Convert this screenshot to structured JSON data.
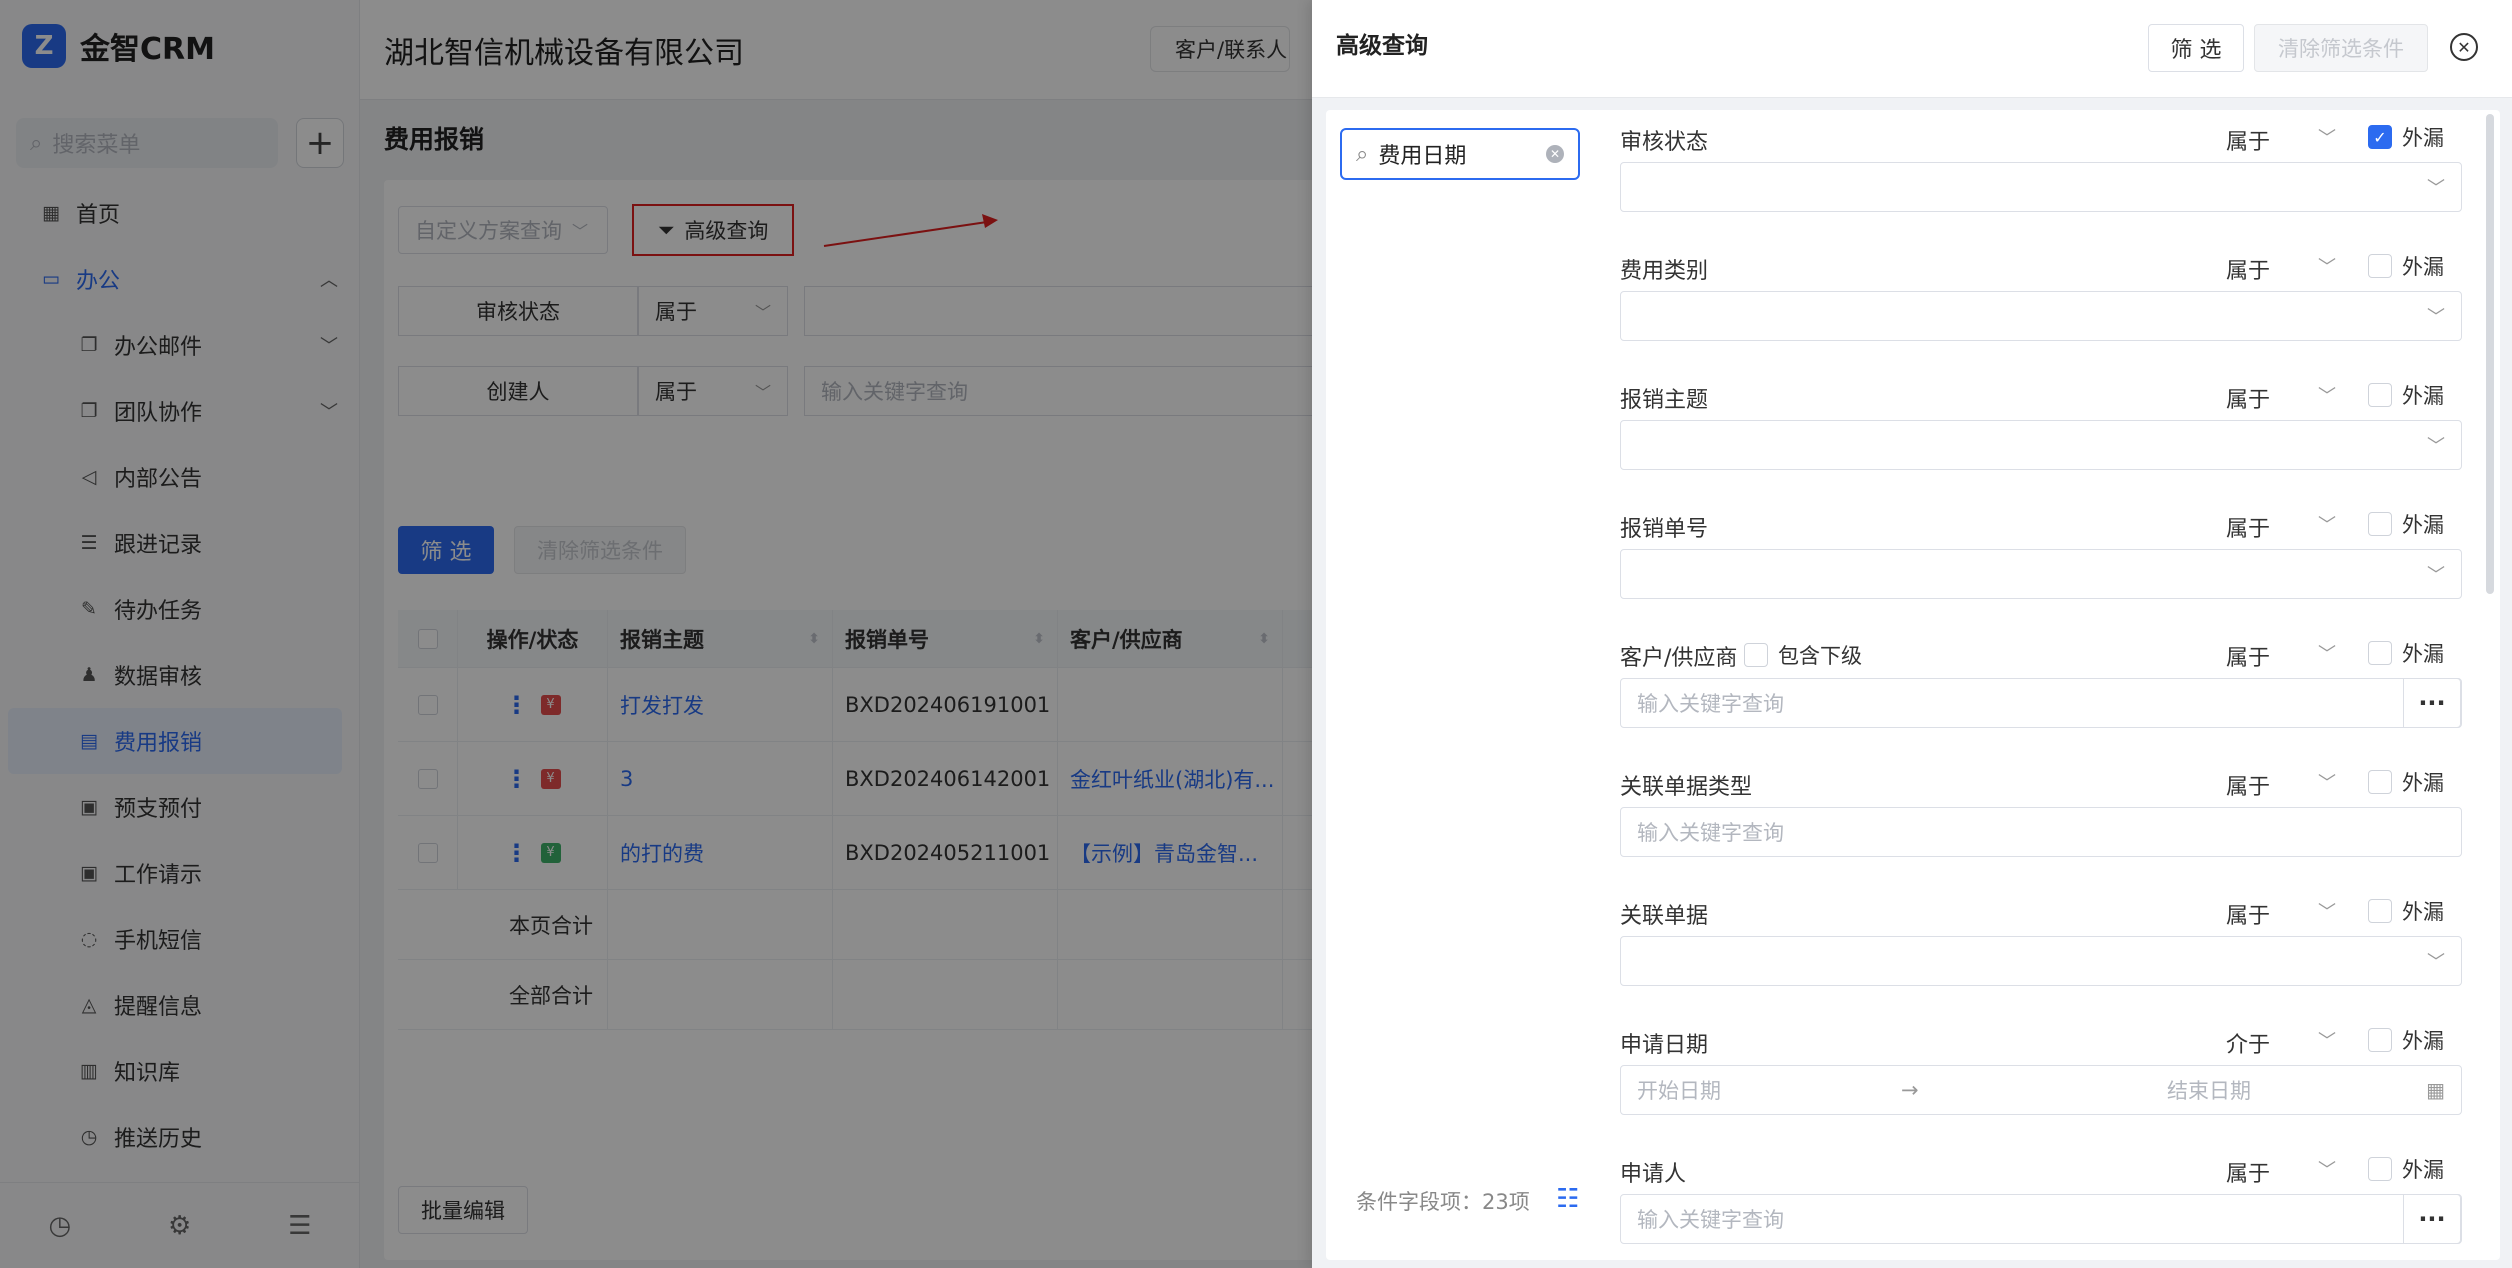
{
  "brand": {
    "logo_letter": "Z",
    "name": "金智CRM"
  },
  "sidebar": {
    "search_placeholder": "搜索菜单",
    "add_symbol": "+",
    "items": [
      {
        "label": "首页",
        "icon": "home-icon",
        "glyph": "▦"
      },
      {
        "label": "办公",
        "icon": "office-icon",
        "glyph": "▭"
      },
      {
        "label": "办公邮件",
        "icon": "mail-icon",
        "glyph": "❐"
      },
      {
        "label": "团队协作",
        "icon": "team-icon",
        "glyph": "❐"
      },
      {
        "label": "内部公告",
        "icon": "announce-icon",
        "glyph": "◁"
      },
      {
        "label": "跟进记录",
        "icon": "record-icon",
        "glyph": "☰"
      },
      {
        "label": "待办任务",
        "icon": "pin-icon",
        "glyph": "✎"
      },
      {
        "label": "数据审核",
        "icon": "audit-icon",
        "glyph": "♟"
      },
      {
        "label": "费用报销",
        "icon": "expense-icon",
        "glyph": "▤"
      },
      {
        "label": "预支预付",
        "icon": "prepay-icon",
        "glyph": "▣"
      },
      {
        "label": "工作请示",
        "icon": "request-icon",
        "glyph": "▣"
      },
      {
        "label": "手机短信",
        "icon": "sms-icon",
        "glyph": "◌"
      },
      {
        "label": "提醒信息",
        "icon": "bell-icon",
        "glyph": "◬"
      },
      {
        "label": "知识库",
        "icon": "book-icon",
        "glyph": "▥"
      },
      {
        "label": "推送历史",
        "icon": "clock-icon",
        "glyph": "◷"
      }
    ],
    "bottom_icons": [
      "history-icon",
      "settings-icon",
      "collapse-icon"
    ],
    "bottom_glyphs": [
      "◷",
      "⚙",
      "☰"
    ]
  },
  "topbar": {
    "company": "湖北智信机械设备有限公司",
    "select": "客户/联系人"
  },
  "page": {
    "title": "费用报销",
    "scheme_placeholder": "自定义方案查询",
    "adv_query": "高级查询",
    "filters": [
      {
        "label": "审核状态",
        "op": "属于",
        "value": ""
      },
      {
        "label": "创建人",
        "op": "属于",
        "value": "输入关键字查询"
      }
    ],
    "btn_filter": "筛 选",
    "btn_clear": "清除筛选条件",
    "columns": [
      "操作/状态",
      "报销主题",
      "报销单号",
      "客户/供应商"
    ],
    "rows": [
      {
        "tag": "¥",
        "tag_color": "#e54d4d",
        "subject": "打发打发",
        "no": "BXD202406191001",
        "customer": ""
      },
      {
        "tag": "¥",
        "tag_color": "#e54d4d",
        "subject": "3",
        "no": "BXD202406142001",
        "customer": "金红叶纸业(湖北)有..."
      },
      {
        "tag": "¥",
        "tag_color": "#3fb36b",
        "subject": "的打的费",
        "no": "BXD202405211001",
        "customer": "【示例】青岛金智..."
      }
    ],
    "sum_page": "本页合计",
    "sum_all": "全部合计",
    "batch_edit": "批量编辑"
  },
  "drawer": {
    "title": "高级查询",
    "btn_filter": "筛 选",
    "btn_clear": "清除筛选条件",
    "close_icon": "close-circle-icon",
    "field_search": "费用日期",
    "cond_count": "条件字段项：23项",
    "leak_label": "外漏",
    "include_sub": "包含下级",
    "fields": [
      {
        "label": "审核状态",
        "op": "属于",
        "leak": true,
        "kind": "select",
        "placeholder": ""
      },
      {
        "label": "费用类别",
        "op": "属于",
        "leak": false,
        "kind": "select",
        "placeholder": ""
      },
      {
        "label": "报销主题",
        "op": "属于",
        "leak": false,
        "kind": "select",
        "placeholder": ""
      },
      {
        "label": "报销单号",
        "op": "属于",
        "leak": false,
        "kind": "select",
        "placeholder": ""
      },
      {
        "label": "客户/供应商",
        "op": "属于",
        "leak": false,
        "kind": "lookup",
        "placeholder": "输入关键字查询"
      },
      {
        "label": "关联单据类型",
        "op": "属于",
        "leak": false,
        "kind": "input",
        "placeholder": "输入关键字查询"
      },
      {
        "label": "关联单据",
        "op": "属于",
        "leak": false,
        "kind": "select",
        "placeholder": ""
      },
      {
        "label": "申请日期",
        "op": "介于",
        "leak": false,
        "kind": "daterange",
        "start": "开始日期",
        "end": "结束日期"
      },
      {
        "label": "申请人",
        "op": "属于",
        "leak": false,
        "kind": "lookup",
        "placeholder": "输入关键字查询"
      }
    ]
  },
  "colors": {
    "accent": "#2c6bf0",
    "highlight_border": "#e02020"
  }
}
